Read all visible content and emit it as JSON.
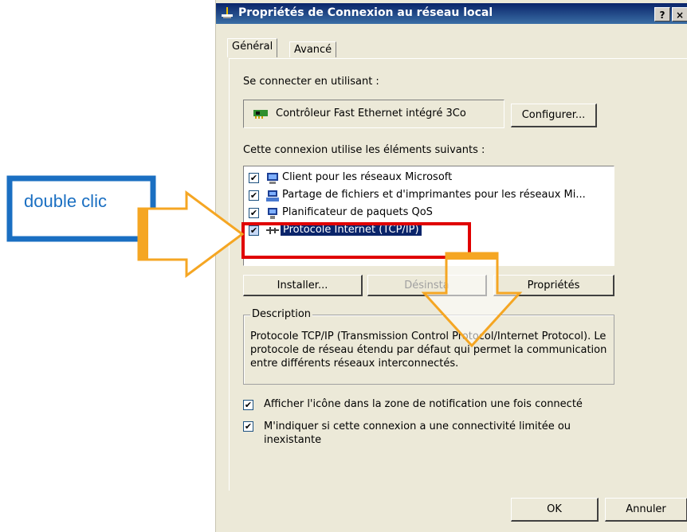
{
  "window": {
    "title": "Propriétés de Connexion au réseau local",
    "help_btn": "?",
    "close_btn": "×"
  },
  "tabs": [
    {
      "label": "Général",
      "active": true
    },
    {
      "label": "Avancé",
      "active": false
    }
  ],
  "connect_using": {
    "label": "Se connecter en utilisant :",
    "adapter": "Contrôleur Fast Ethernet intégré 3Co",
    "configure_btn": "Configurer..."
  },
  "components": {
    "label": "Cette connexion utilise les éléments suivants :",
    "items": [
      {
        "label": "Client pour les réseaux Microsoft",
        "checked": true,
        "icon": "network-client-icon"
      },
      {
        "label": "Partage de fichiers et d'imprimantes pour les réseaux Mi...",
        "checked": true,
        "icon": "printer-share-icon"
      },
      {
        "label": "Planificateur de paquets QoS",
        "checked": true,
        "icon": "qos-scheduler-icon"
      },
      {
        "label": "Protocole Internet (TCP/IP)",
        "checked": true,
        "selected": true,
        "icon": "protocol-icon"
      }
    ]
  },
  "buttons": {
    "install": "Installer...",
    "uninstall": "Désinsta",
    "properties": "Propriétés",
    "ok": "OK",
    "cancel": "Annuler"
  },
  "description": {
    "title": "Description",
    "text": "Protocole TCP/IP (Transmission Control Protocol/Internet Protocol). Le protocole de réseau étendu par défaut qui permet la communication entre différents réseaux interconnectés."
  },
  "options": [
    {
      "label": "Afficher l'icône dans la zone de notification une fois connecté",
      "checked": true
    },
    {
      "label": "M'indiquer si cette connexion a une connectivité limitée ou inexistante",
      "checked": true
    }
  ],
  "annotation": {
    "label": "double clic",
    "accent_blue": "#1a6fc2",
    "accent_orange": "#f5a623",
    "highlight_red": "#e00000"
  }
}
